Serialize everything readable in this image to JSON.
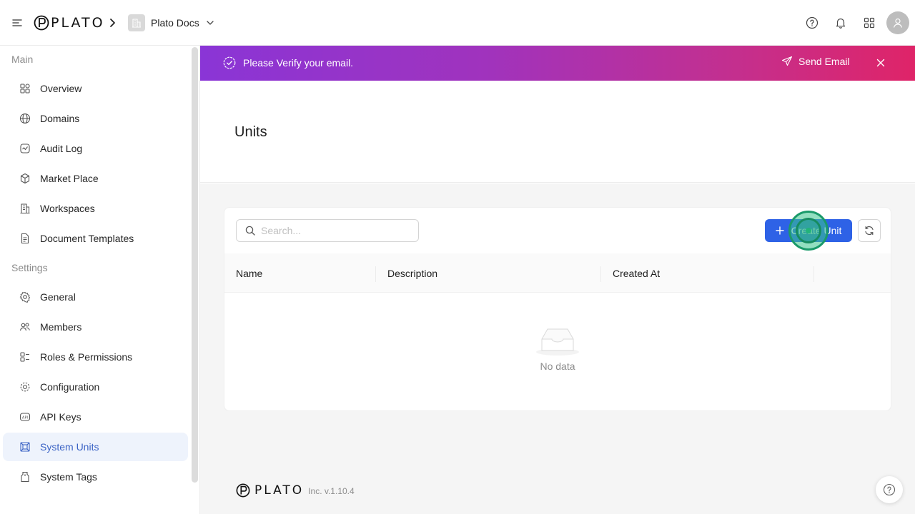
{
  "header": {
    "logo_text": "PLATO",
    "workspace_name": "Plato Docs",
    "icons": [
      "menu-icon",
      "chevron-right-icon",
      "building-icon",
      "chevron-down-icon",
      "help-icon",
      "bell-icon",
      "apps-grid-icon",
      "user-icon"
    ]
  },
  "sidebar": {
    "sections": [
      {
        "title": "Main",
        "items": [
          {
            "label": "Overview",
            "icon": "overview-icon"
          },
          {
            "label": "Domains",
            "icon": "globe-icon"
          },
          {
            "label": "Audit Log",
            "icon": "audit-log-icon"
          },
          {
            "label": "Market Place",
            "icon": "cube-icon"
          },
          {
            "label": "Workspaces",
            "icon": "building-icon"
          },
          {
            "label": "Document Templates",
            "icon": "document-icon"
          }
        ]
      },
      {
        "title": "Settings",
        "items": [
          {
            "label": "General",
            "icon": "gear-icon"
          },
          {
            "label": "Members",
            "icon": "members-icon"
          },
          {
            "label": "Roles & Permissions",
            "icon": "roles-icon"
          },
          {
            "label": "Configuration",
            "icon": "configuration-icon"
          },
          {
            "label": "API Keys",
            "icon": "api-icon"
          },
          {
            "label": "System Units",
            "icon": "units-icon",
            "active": true
          },
          {
            "label": "System Tags",
            "icon": "tag-icon"
          }
        ]
      }
    ]
  },
  "banner": {
    "message": "Please Verify your email.",
    "action_label": "Send Email"
  },
  "page": {
    "title": "Units"
  },
  "toolbar": {
    "search_placeholder": "Search...",
    "search_value": "",
    "create_label": "Create Unit"
  },
  "table": {
    "columns": [
      "Name",
      "Description",
      "Created At"
    ],
    "rows": [],
    "empty_text": "No data"
  },
  "footer": {
    "logo_text": "PLATO",
    "version": "Inc. v.1.10.4"
  },
  "colors": {
    "primary": "#2e62e6",
    "active_bg": "#eef3fc",
    "active_text": "#3b63c5",
    "banner_start": "#8a35d6",
    "banner_end": "#df2468"
  }
}
